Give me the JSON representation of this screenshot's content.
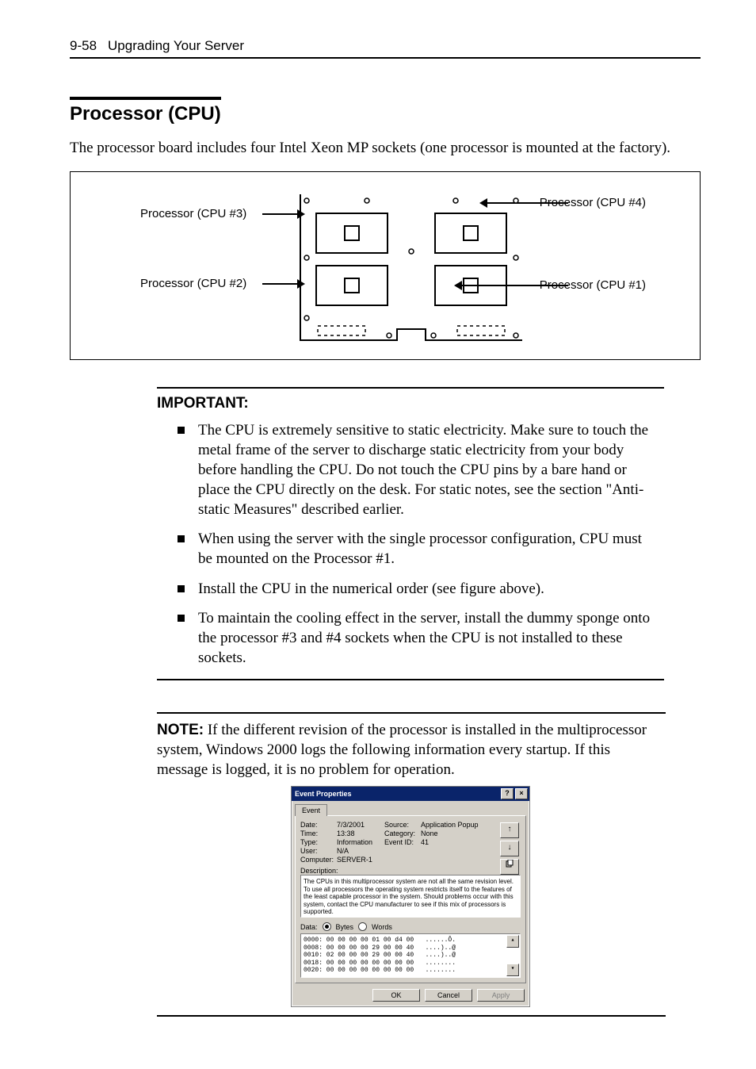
{
  "runhead": {
    "pageno": "9-58",
    "title": "Upgrading Your Server"
  },
  "section_title": "Processor (CPU)",
  "intro": "The processor board includes four Intel Xeon MP sockets (one processor is mounted at the factory).",
  "figure": {
    "label3": "Processor (CPU #3)",
    "label4": "Processor (CPU #4)",
    "label2": "Processor (CPU #2)",
    "label1": "Processor (CPU #1)"
  },
  "important": {
    "heading": "IMPORTANT:",
    "items": [
      "The CPU is extremely sensitive to static electricity. Make sure to touch the metal frame of the server to discharge static electricity from your body before handling the CPU. Do not touch the CPU pins by a bare hand or place the CPU directly on the desk. For static notes, see the section \"Anti-static Measures\" described earlier.",
      "When using the server with the single processor configuration, CPU must be mounted on the Processor #1.",
      "Install the CPU in the numerical order (see figure above).",
      "To maintain the cooling effect in the server, install the dummy sponge onto the processor #3 and #4 sockets when the CPU is not installed to these sockets."
    ]
  },
  "note": {
    "label": "NOTE:",
    "text": " If the different revision of the processor is installed in the multiprocessor system, Windows 2000 logs the following information every startup. If this message is logged, it is no problem for operation."
  },
  "evt": {
    "title": "Event Properties",
    "help": "?",
    "close": "×",
    "tab": "Event",
    "labels": {
      "date": "Date:",
      "time": "Time:",
      "type": "Type:",
      "user": "User:",
      "computer": "Computer:",
      "source": "Source:",
      "category": "Category:",
      "eventid": "Event ID:",
      "description": "Description:",
      "data": "Data:",
      "bytes": "Bytes",
      "words": "Words"
    },
    "values": {
      "date": "7/3/2001",
      "time": "13:38",
      "type": "Information",
      "user": "N/A",
      "computer": "SERVER-1",
      "source": "Application Popup",
      "category": "None",
      "eventid": "41"
    },
    "arrow_up": "↑",
    "arrow_down": "↓",
    "description": "The CPUs in this multiprocessor system are not all the same revision level. To use all processors the operating system restricts itself to the features of the least capable processor in the system. Should problems occur with this system, contact the CPU manufacturer to see if this mix of processors is supported.",
    "hexdump": "0000: 00 00 00 00 01 00 d4 00   ......Ô.\n0008: 00 00 00 00 29 00 00 40   ....)..@\n0010: 02 00 00 00 29 00 00 40   ....)..@\n0018: 00 00 00 00 00 00 00 00   ........\n0020: 00 00 00 00 00 00 00 00   ........",
    "buttons": {
      "ok": "OK",
      "cancel": "Cancel",
      "apply": "Apply"
    }
  }
}
